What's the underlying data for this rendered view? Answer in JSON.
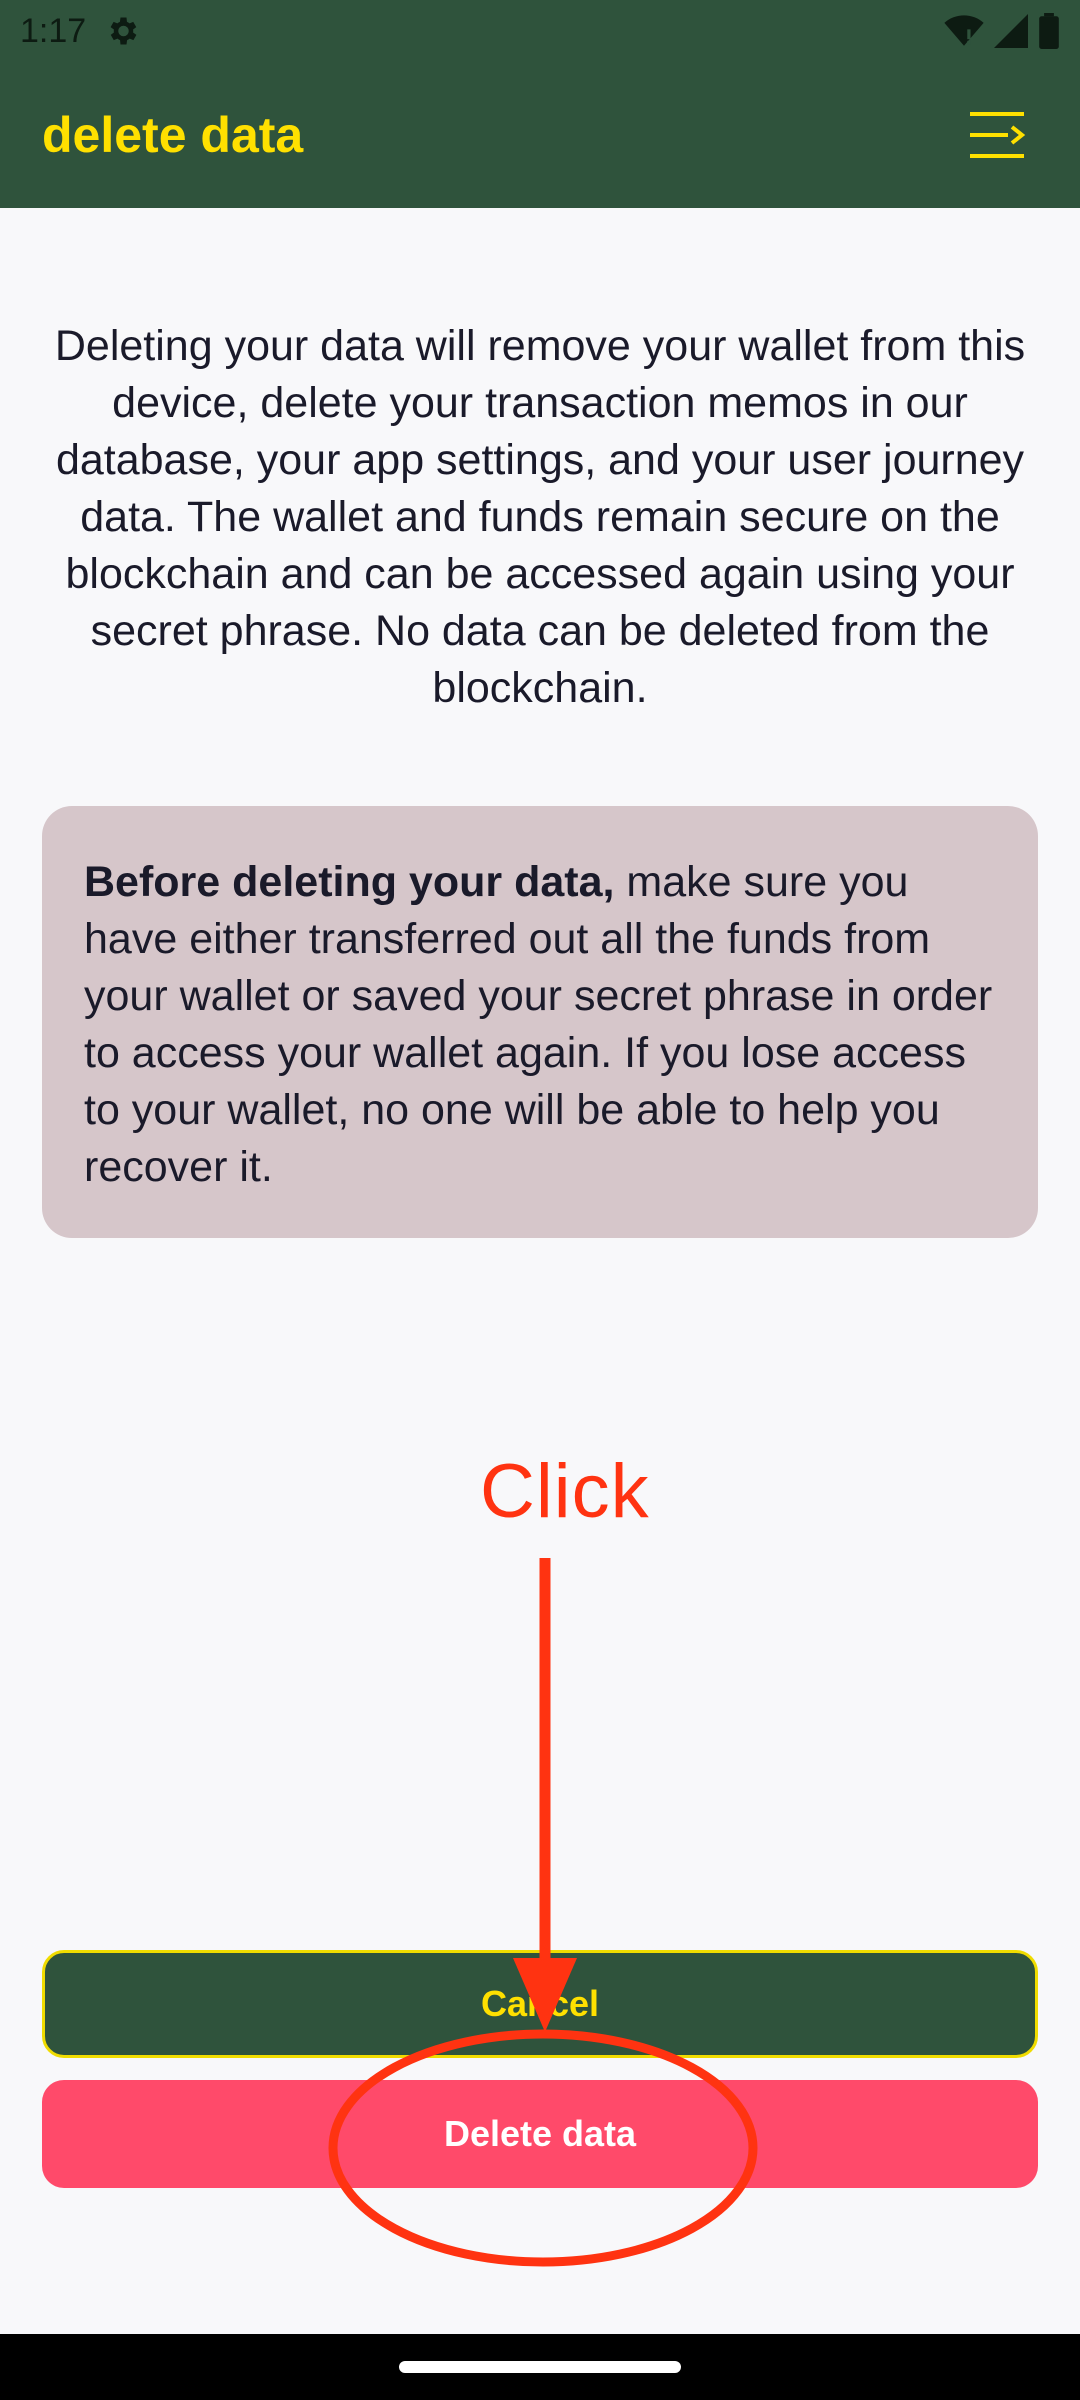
{
  "status_bar": {
    "time": "1:17"
  },
  "app_bar": {
    "title": "delete data"
  },
  "content": {
    "intro": "Deleting your data will remove your wallet from this device, delete your transaction memos in our database, your app settings, and your user journey data. The wallet and funds remain secure on the blockchain and can be accessed again using your secret phrase. No data can be deleted from the blockchain.",
    "warning_bold": "Before deleting your data,",
    "warning_rest": " make sure you have either transferred out all the funds from your wallet or saved your secret phrase in order to access your wallet again. If you lose access to your wallet, no one will be able to help you recover it."
  },
  "annotation": {
    "label": "Click"
  },
  "buttons": {
    "cancel_label": "Cancel",
    "delete_label": "Delete data"
  },
  "colors": {
    "header_bg": "#2f533c",
    "title_accent": "#ffe000",
    "warning_bg": "#d6c6ca",
    "delete_bg": "#ff4a6a",
    "annotation": "#ff3311"
  }
}
